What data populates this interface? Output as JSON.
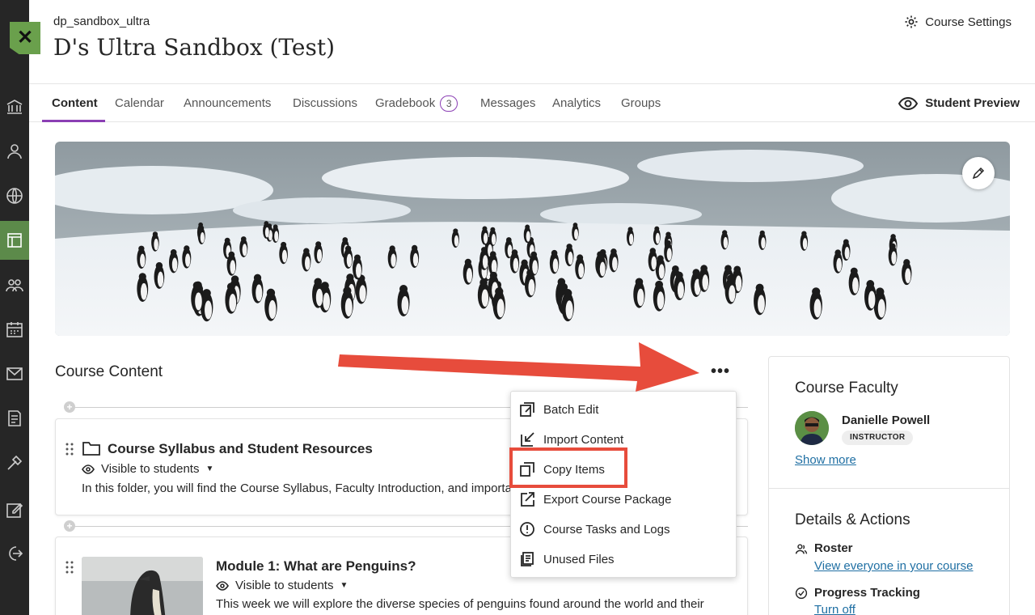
{
  "header": {
    "course_id": "dp_sandbox_ultra",
    "course_title": "D's Ultra Sandbox (Test)",
    "settings_label": "Course Settings",
    "close_label": "✕"
  },
  "tabs": [
    {
      "label": "Content"
    },
    {
      "label": "Calendar"
    },
    {
      "label": "Announcements"
    },
    {
      "label": "Discussions"
    },
    {
      "label": "Gradebook",
      "badge": "3"
    },
    {
      "label": "Messages"
    },
    {
      "label": "Analytics"
    },
    {
      "label": "Groups"
    }
  ],
  "student_preview_label": "Student Preview",
  "content": {
    "title": "Course Content",
    "more_label": "•••",
    "items": [
      {
        "title": "Course Syllabus and Student Resources",
        "visibility": "Visible to students",
        "description": "In this folder, you will find the Course Syllabus, Faculty Introduction, and importar"
      },
      {
        "title": "Module 1: What are Penguins?",
        "visibility": "Visible to students",
        "description": "This week we will explore the diverse species of penguins found around the world and their"
      }
    ]
  },
  "menu": {
    "items": [
      {
        "label": "Batch Edit",
        "icon": "batch-edit-icon"
      },
      {
        "label": "Import Content",
        "icon": "import-icon"
      },
      {
        "label": "Copy Items",
        "icon": "copy-icon"
      },
      {
        "label": "Export Course Package",
        "icon": "export-icon"
      },
      {
        "label": "Course Tasks and Logs",
        "icon": "alert-circle-icon"
      },
      {
        "label": "Unused Files",
        "icon": "files-icon"
      }
    ]
  },
  "sidebar": {
    "faculty_title": "Course Faculty",
    "faculty_name": "Danielle Powell",
    "faculty_role": "INSTRUCTOR",
    "show_more": "Show more",
    "details_title": "Details & Actions",
    "roster_label": "Roster",
    "roster_link": "View everyone in your course",
    "progress_label": "Progress Tracking",
    "progress_link": "Turn off"
  },
  "colors": {
    "accent": "#8b3fb4",
    "nav_active": "#5c8a4a",
    "annotation": "#e74c3c",
    "link": "#1f6fa3"
  }
}
